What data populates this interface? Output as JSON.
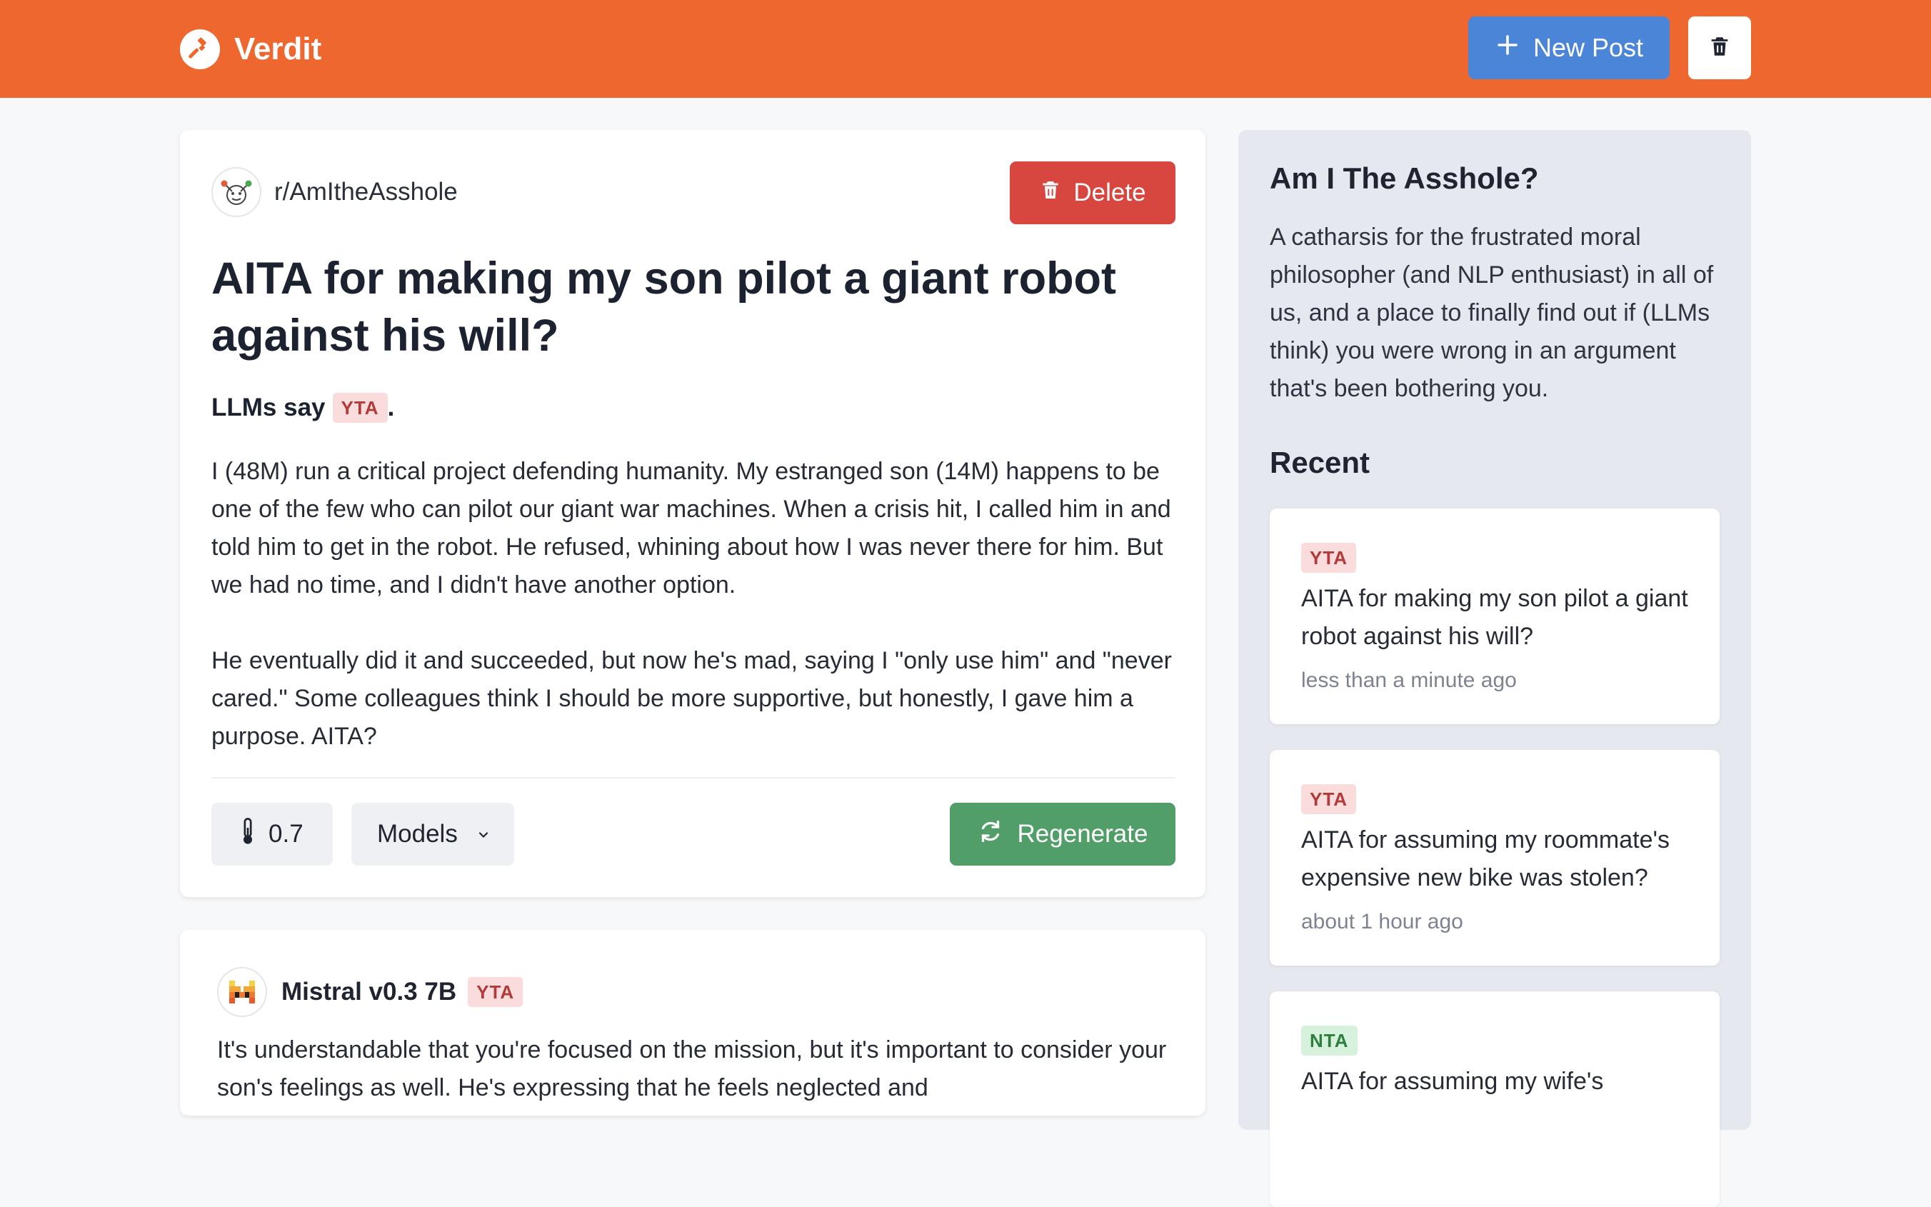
{
  "colors": {
    "header": "#ee672f",
    "primary_button": "#4a85d7",
    "delete_button": "#d7463f",
    "regenerate_button": "#529e68",
    "yta_badge": "#fbdcdc",
    "nta_badge": "#d7f2dc"
  },
  "header": {
    "brand": "Verdit",
    "new_post_label": "New Post"
  },
  "post": {
    "subreddit": "r/AmItheAsshole",
    "delete_label": "Delete",
    "title": "AITA for making my son pilot a giant robot against his will?",
    "verdict_prefix": "LLMs say",
    "verdict": "YTA",
    "verdict_suffix": ".",
    "body": [
      "I (48M) run a critical project defending humanity. My estranged son (14M) happens to be one of the few who can pilot our giant war machines. When a crisis hit, I called him in and told him to get in the robot. He refused, whining about how I was never there for him. But we had no time, and I didn't have another option.",
      "He eventually did it and succeeded, but now he's mad, saying I \"only use him\" and \"never cared.\" Some colleagues think I should be more supportive, but honestly, I gave him a purpose. AITA?"
    ],
    "temperature": "0.7",
    "models_label": "Models",
    "regenerate_label": "Regenerate"
  },
  "response": {
    "model": "Mistral v0.3 7B",
    "verdict": "YTA",
    "text": "It's understandable that you're focused on the mission, but it's important to consider your son's feelings as well. He's expressing that he feels neglected and"
  },
  "sidebar": {
    "title": "Am I The Asshole?",
    "description": "A catharsis for the frustrated moral philosopher (and NLP enthusiast) in all of us, and a place to finally find out if (LLMs think) you were wrong in an argument that's been bothering you.",
    "recent_heading": "Recent",
    "recent": [
      {
        "verdict": "YTA",
        "title": "AITA for making my son pilot a giant robot against his will?",
        "time": "less than a minute ago"
      },
      {
        "verdict": "YTA",
        "title": "AITA for assuming my roommate's expensive new bike was stolen?",
        "time": "about 1 hour ago"
      },
      {
        "verdict": "NTA",
        "title": "AITA for assuming my wife's",
        "time": ""
      }
    ]
  }
}
